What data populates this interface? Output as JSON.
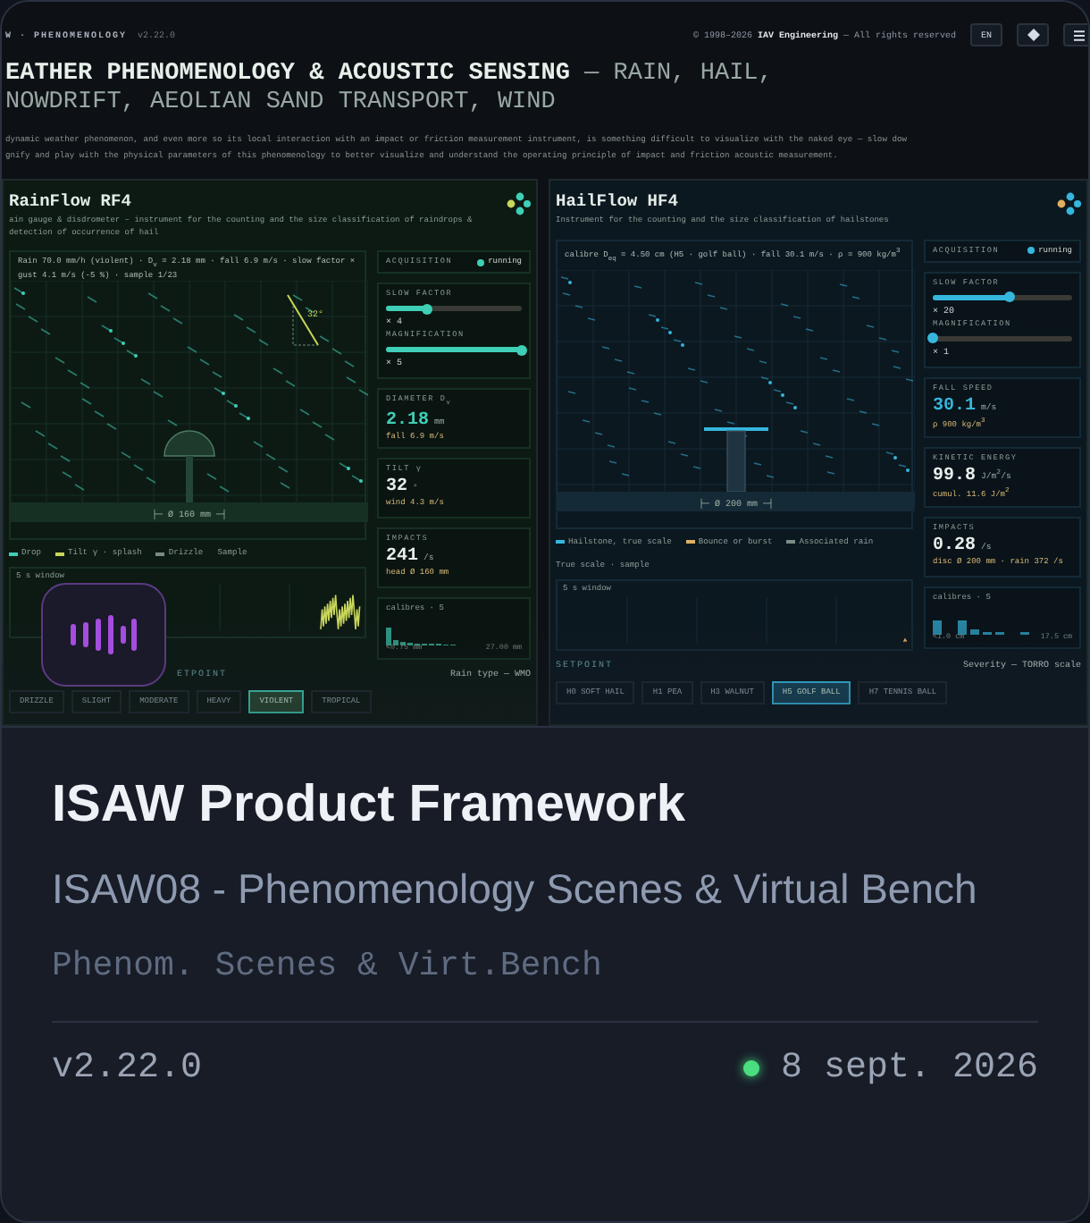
{
  "preview": {
    "header": {
      "brand": "W · PHENOMENOLOGY",
      "version": "v2.22.0",
      "copyright": "© 1998–2026 **IAV Engineering** — All rights reserved",
      "language": "EN"
    },
    "title": "**EATHER PHENOMENOLOGY & ACOUSTIC SENSING** — RAIN, HAIL, NOWDRIFT, AEOLIAN SAND TRANSPORT, WIND",
    "intro": [
      "dynamic weather phenomenon, and even more so its local interaction with an impact or friction measurement instrument, is something difficult to visualize with the naked eye — slow dow",
      "gnify and play with the physical parameters of this phenomenology to better visualize and understand the operating principle of impact and friction acoustic measurement."
    ],
    "panels": [
      {
        "kind": "rain",
        "title": "RainFlow RF4",
        "description": "ain gauge & disdrometer – instrument for the counting and the size classification of raindrops & detection of occurrence of hail",
        "scene_caption": "Rain 70.0 mm/h (violent) · D$_{v}$ = 2.18 mm · fall 6.9 m/s · slow factor × gust 4.1 m/s (-5 %) · sample 1/23",
        "angle_label": "32°",
        "scale_label": "├─ Ø 160 mm ─┤",
        "legend": [
          "Drop",
          "Tilt γ · splash",
          "Drizzle",
          "Sample"
        ],
        "strip_label": "5 s window",
        "acquisition": {
          "label": "ACQUISITION",
          "status": "running",
          "on": true
        },
        "sliders": [
          {
            "label": "SLOW FACTOR",
            "level": 0.3,
            "reading": "× 4"
          },
          {
            "label": "MAGNIFICATION",
            "level": 1.0,
            "reading": "× 5"
          }
        ],
        "metrics": [
          {
            "label": "DIAMETER D$_{v}$",
            "value": "2.18",
            "unit": "mm",
            "note": "fall 6.9 m/s"
          },
          {
            "label": "TILT γ",
            "value": "32",
            "unit": "°",
            "note": "wind 4.3 m/s"
          },
          {
            "label": "IMPACTS",
            "value": "241",
            "unit": "/s",
            "note": "head Ø 160 mm"
          }
        ],
        "histogram": {
          "label": "calibres · 5",
          "min": "<0.75 mm",
          "max": "27.00 mm"
        },
        "setpoint": {
          "label": "ETPOINT",
          "scale": "Rain type — WMO"
        },
        "options": [
          {
            "label": "DRIZZLE",
            "selected": false
          },
          {
            "label": "SLIGHT",
            "selected": false
          },
          {
            "label": "MODERATE",
            "selected": false
          },
          {
            "label": "HEAVY",
            "selected": false
          },
          {
            "label": "VIOLENT",
            "selected": true
          },
          {
            "label": "TROPICAL",
            "selected": false
          }
        ]
      },
      {
        "kind": "hail",
        "title": "HailFlow HF4",
        "description": "Instrument for the counting and the size classification of hailstones",
        "scene_caption": "calibre D$_{eq}$ = 4.50 cm (H5 · golf ball) · fall 30.1 m/s · ρ = 900 kg/m$^{3}$",
        "scale_label": "├─ Ø 200 mm ─┤",
        "legend": [
          "Hailstone, true scale",
          "Bounce or burst",
          "Associated rain"
        ],
        "section_label": "True scale · sample",
        "strip_label": "5 s window",
        "acquisition": {
          "label": "ACQUISITION",
          "status": "running",
          "on": true
        },
        "sliders": [
          {
            "label": "SLOW FACTOR",
            "level": 0.55,
            "reading": "× 20"
          },
          {
            "label": "MAGNIFICATION",
            "level": 0.0,
            "reading": "× 1"
          }
        ],
        "metrics": [
          {
            "label": "FALL SPEED",
            "value": "30.1",
            "unit": "m/s",
            "note": "ρ 900 kg/m$^{3}$"
          },
          {
            "label": "KINETIC ENERGY",
            "value": "99.8",
            "unit": "J/m$^{2}$/s",
            "note": "cumul. 11.6 J/m$^{2}$"
          },
          {
            "label": "IMPACTS",
            "value": "0.28",
            "unit": "/s",
            "note": "disc Ø 200 mm · rain 372 /s"
          }
        ],
        "histogram": {
          "label": "calibres · 5",
          "min": "<1.0 cm",
          "max": "17.5 cm"
        },
        "setpoint": {
          "label": "SETPOINT",
          "scale": "Severity — TORRO scale"
        },
        "options": [
          {
            "label": "H0 SOFT HAIL",
            "selected": false
          },
          {
            "label": "H1 PEA",
            "selected": false
          },
          {
            "label": "H3 WALNUT",
            "selected": false
          },
          {
            "label": "H5 GOLF BALL",
            "selected": true
          },
          {
            "label": "H7 TENNIS BALL",
            "selected": false
          }
        ]
      }
    ]
  },
  "card": {
    "title": "ISAW Product Framework",
    "subtitle": "ISAW08 - Phenomenology Scenes & Virtual Bench",
    "tagline": "Phenom. Scenes & Virt.Bench",
    "version": "v2.22.0",
    "status": {
      "color": "#4ade80"
    },
    "date": "8 sept. 2026"
  }
}
